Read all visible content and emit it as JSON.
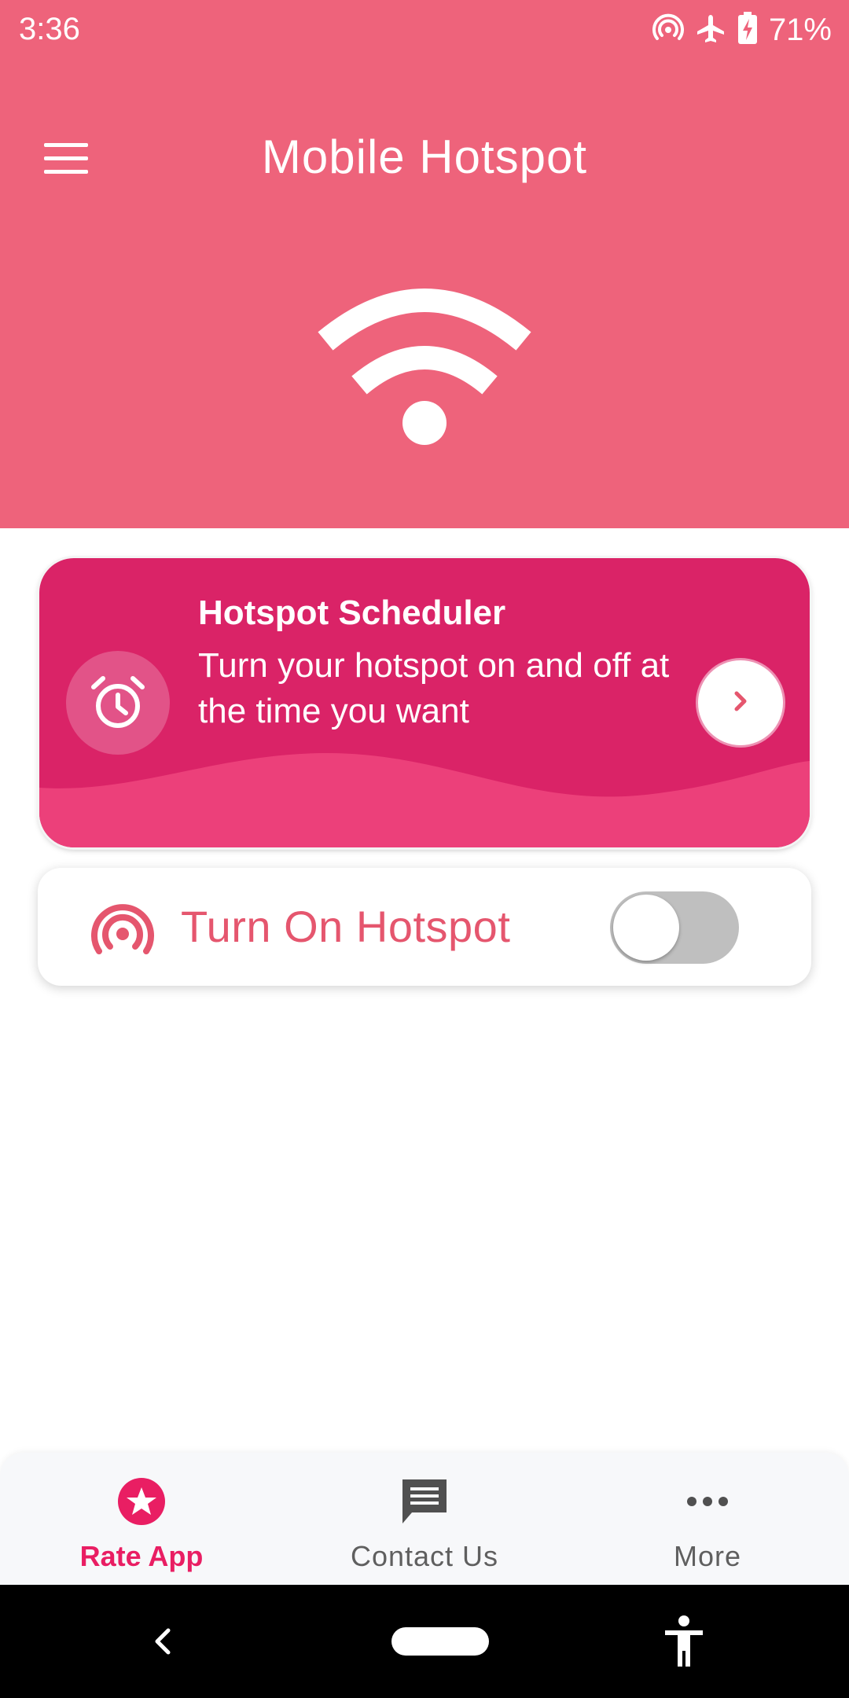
{
  "status_bar": {
    "time": "3:36",
    "battery_percent": "71%",
    "icons": [
      "hotspot-icon",
      "airplane-icon",
      "battery-charging-icon"
    ]
  },
  "app_bar": {
    "title": "Mobile Hotspot",
    "menu_icon": "menu-icon"
  },
  "hero": {
    "icon": "wifi-icon"
  },
  "scheduler_card": {
    "title": "Hotspot Scheduler",
    "description": "Turn your hotspot on and off at the time you want",
    "icon": "alarm-clock-icon",
    "action_icon": "chevron-right-icon"
  },
  "hotspot_toggle": {
    "label": "Turn On Hotspot",
    "icon": "hotspot-icon",
    "enabled": false
  },
  "bottom_nav": {
    "items": [
      {
        "label": "Rate App",
        "icon": "star-icon",
        "active": true
      },
      {
        "label": "Contact Us",
        "icon": "message-icon",
        "active": false
      },
      {
        "label": "More",
        "icon": "more-dots-icon",
        "active": false
      }
    ]
  },
  "system_nav": {
    "icons": [
      "back-icon",
      "home-pill-icon",
      "accessibility-icon"
    ]
  },
  "colors": {
    "header": "#EE637B",
    "card": "#DA2367",
    "accent": "#E91E63",
    "label": "#E5566E"
  }
}
